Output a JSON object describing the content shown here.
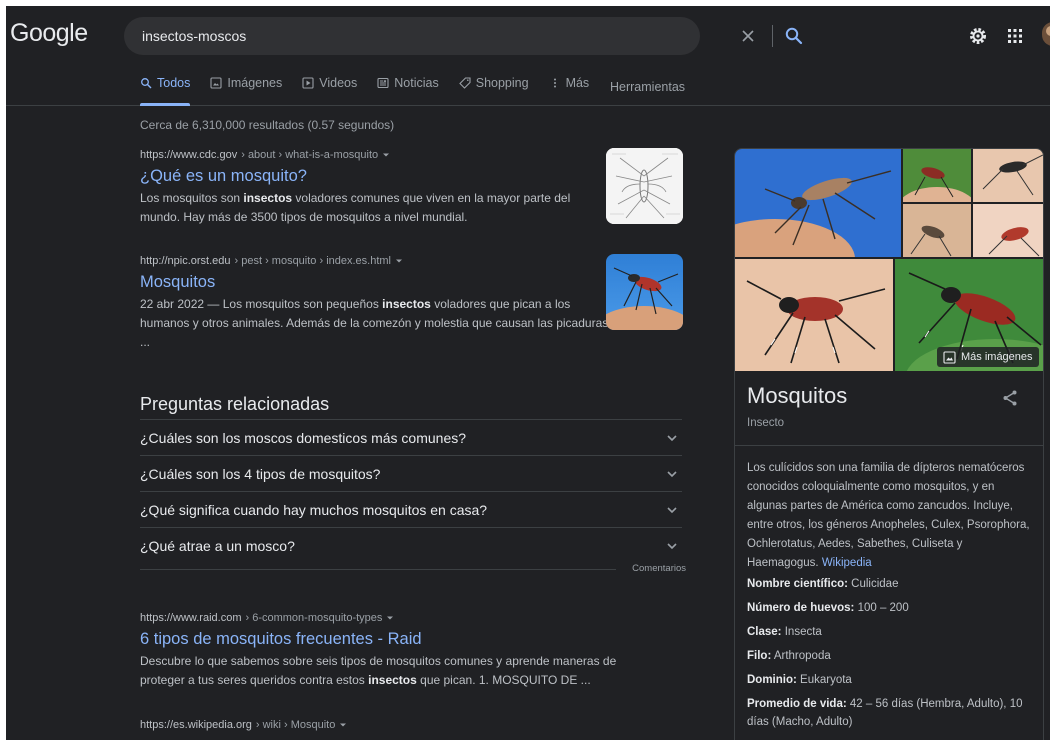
{
  "header": {
    "logo": "Google",
    "search_query": "insectos-moscos"
  },
  "tabs": [
    {
      "label": "Todos",
      "icon": "search-icon",
      "active": true
    },
    {
      "label": "Imágenes",
      "icon": "image-icon"
    },
    {
      "label": "Videos",
      "icon": "play-icon"
    },
    {
      "label": "Noticias",
      "icon": "newspaper-icon"
    },
    {
      "label": "Shopping",
      "icon": "tag-icon"
    },
    {
      "label": "Más",
      "icon": "more-vert-icon"
    }
  ],
  "tools_label": "Herramientas",
  "results_count": "Cerca de 6,310,000 resultados (0.57 segundos)",
  "results": [
    {
      "domain": "https://www.cdc.gov",
      "path": " › about › what-is-a-mosquito",
      "title": "¿Qué es un mosquito?",
      "snippet_html": "Los mosquitos son <b>insectos</b> voladores comunes que viven en la mayor parte del mundo. Hay más de 3500 tipos de mosquitos a nivel mundial."
    },
    {
      "domain": "http://npic.orst.edu",
      "path": " › pest › mosquito › index.es.html",
      "title": "Mosquitos",
      "snippet_html": "22 abr 2022 — Los mosquitos son pequeños <b>insectos</b> voladores que pican a los humanos y otros animales. Además de la comezón y molestia que causan las picaduras ..."
    },
    {
      "domain": "https://www.raid.com",
      "path": " › 6-common-mosquito-types",
      "title": "6 tipos de mosquitos frecuentes - Raid",
      "snippet_html": "Descubre lo que sabemos sobre seis tipos de mosquitos comunes y aprende maneras de proteger a tus seres queridos contra estos <b>insectos</b> que pican. 1. MOSQUITO DE ..."
    },
    {
      "domain": "https://es.wikipedia.org",
      "path": " › wiki › Mosquito"
    }
  ],
  "paa": {
    "title": "Preguntas relacionadas",
    "questions": [
      "¿Cuáles son los moscos domesticos más comunes?",
      "¿Cuáles son los 4 tipos de mosquitos?",
      "¿Qué significa cuando hay muchos mosquitos en casa?",
      "¿Qué atrae a un mosco?"
    ],
    "feedback": "Comentarios"
  },
  "knowledge_panel": {
    "more_images": "Más imágenes",
    "title": "Mosquitos",
    "subtitle": "Insecto",
    "description": "Los culícidos son una familia de dípteros nematóceros conocidos coloquialmente como mosquitos, y en algunas partes de América como zancudos. Incluye, entre otros, los géneros Anopheles, Culex, Psorophora, Ochlerotatus, Aedes, Sabethes, Culiseta y Haemagogus.",
    "source_link": "Wikipedia",
    "facts": [
      {
        "label": "Nombre científico:",
        "value": "Culicidae"
      },
      {
        "label": "Número de huevos:",
        "value": "100 – 200"
      },
      {
        "label": "Clase:",
        "value": "Insecta"
      },
      {
        "label": "Filo:",
        "value": "Arthropoda"
      },
      {
        "label": "Dominio:",
        "value": "Eukaryota"
      },
      {
        "label": "Promedio de vida:",
        "value": "42 – 56 días (Hembra, Adulto), 10 días (Macho, Adulto)"
      }
    ]
  },
  "colors": {
    "background": "#202124",
    "link": "#8ab4f8",
    "text": "#bdc1c6"
  }
}
